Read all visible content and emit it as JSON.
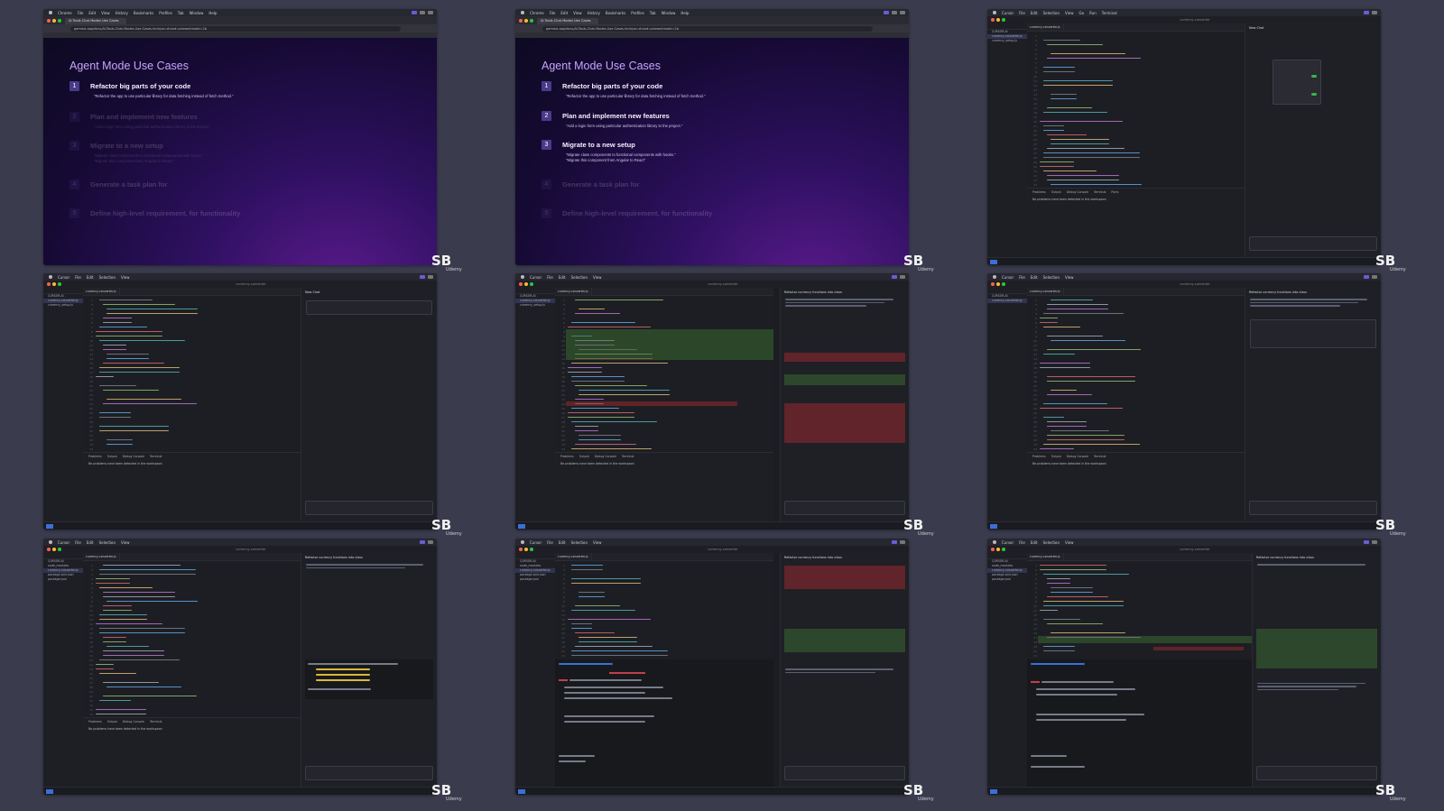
{
  "watermark": {
    "logo": "SB",
    "sub": "Udemy"
  },
  "browser": {
    "menu": [
      "Chrome",
      "File",
      "Edit",
      "View",
      "History",
      "Bookmarks",
      "Profiles",
      "Tab",
      "Window",
      "Help"
    ],
    "tab_title": "AI Tools Chat Modes Use Cases",
    "url": "gamma.app/docs/AI-Tools-Chat-Modes-Use-Cases-kmhyw=#card=presentmode=2b"
  },
  "slide": {
    "title": "Agent Mode Use Cases",
    "items": [
      {
        "num": "1",
        "head": "Refactor big parts of your code",
        "bullets": [
          "\"Refactor the app to use particular library for data fetching instead of fetch method.\""
        ]
      },
      {
        "num": "2",
        "head": "Plan and implement new features",
        "bullets": [
          "\"Add a login form using particular authentication library to the project.\""
        ]
      },
      {
        "num": "3",
        "head": "Migrate to a new setup",
        "bullets": [
          "\"Migrate class components to functional components with hooks.\"",
          "\"Migrate this component from Angular to React\""
        ]
      },
      {
        "num": "4",
        "head": "Generate a task plan for",
        "bullets": []
      },
      {
        "num": "5",
        "head": "Define high-level requirement, for functionality",
        "bullets": []
      }
    ]
  },
  "ide": {
    "menu": [
      "Cursor",
      "File",
      "Edit",
      "Selection",
      "View",
      "Go",
      "Run",
      "Terminal",
      "Window",
      "Help"
    ],
    "window_title": "currency-converter",
    "file_tab": "currency-converter.js",
    "panel_tabs": [
      "Problems",
      "Output",
      "Debug Console",
      "Terminal",
      "Ports"
    ],
    "panel_message": "No problems have been detected in the workspace.",
    "chat_title": "New Chat",
    "chat_title_2": "Refactor currency functions into class",
    "tree": [
      "CURSOR-AI",
      "currency-converter.js",
      "currency_setup.js"
    ],
    "tree_2": [
      "CURSOR-AI",
      "node_modules",
      "currency-converter.js",
      "package-lock.json",
      "package.json"
    ],
    "terminal_fail": "FAIL"
  }
}
